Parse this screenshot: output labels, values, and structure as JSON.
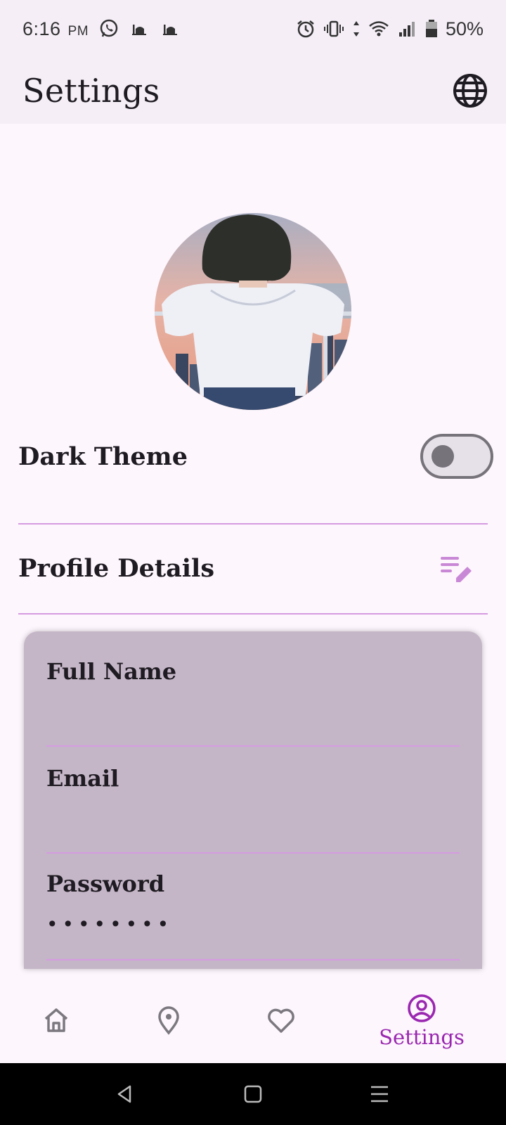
{
  "status_bar": {
    "time": "6:16",
    "ampm": "PM",
    "battery_percent": "50%",
    "left_icons": [
      "whatsapp-icon",
      "mosque-icon",
      "mosque-icon"
    ],
    "right_icons": [
      "alarm-icon",
      "vibrate-icon",
      "data-arrows-icon",
      "wifi-icon",
      "signal-icon",
      "battery-icon"
    ]
  },
  "app_bar": {
    "title": "Settings",
    "action_icon": "globe-icon"
  },
  "settings": {
    "dark_theme_label": "Dark Theme",
    "dark_theme_enabled": false,
    "profile_details_label": "Profile Details",
    "profile_edit_icon": "edit-note-icon"
  },
  "profile_form": {
    "full_name_label": "Full Name",
    "full_name_value": "",
    "email_label": "Email",
    "email_value": "",
    "password_label": "Password",
    "password_value": "••••••••"
  },
  "bottom_nav": {
    "items": [
      {
        "icon": "home-icon",
        "label": "",
        "active": false
      },
      {
        "icon": "location-pin-icon",
        "label": "",
        "active": false
      },
      {
        "icon": "heart-icon",
        "label": "",
        "active": false
      },
      {
        "icon": "account-circle-icon",
        "label": "Settings",
        "active": true
      }
    ]
  },
  "colors": {
    "accent": "#9a27b0",
    "divider": "#d59be0",
    "card_background": "#c4b6c7",
    "background": "#fdf6fd"
  }
}
